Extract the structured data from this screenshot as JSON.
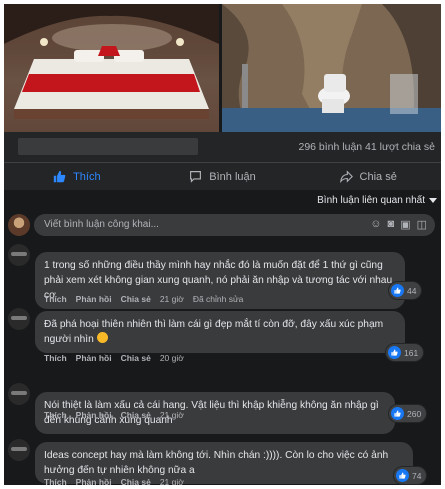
{
  "post": {
    "stats_text": "296 bình luận  41 lượt chia sẻ"
  },
  "actions": {
    "like_label": "Thích",
    "comment_label": "Bình luận",
    "share_label": "Chia sẻ"
  },
  "sort": {
    "label": "Bình luận liên quan nhất"
  },
  "composer": {
    "placeholder": "Viết bình luận công khai..."
  },
  "comments": [
    {
      "text": "1 trong số những điều thầy mình hay nhắc đó là muốn đặt để 1 thứ gì cũng phải xem xét không gian xung quanh, nó phải ăn nhập và tương tác với nhau cơ",
      "like_label": "Thích",
      "reply_label": "Phản hồi",
      "share_label": "Chia sẻ",
      "time": "21 giờ",
      "edited": "Đã chỉnh sửa",
      "reactions": "44"
    },
    {
      "text": "Đã phá hoại thiên nhiên thì làm cái gì đẹp mắt tí còn đỡ, đây xấu xúc phạm người nhìn",
      "like_label": "Thích",
      "reply_label": "Phản hồi",
      "share_label": "Chia sẻ",
      "time": "20 giờ",
      "reactions": "161"
    },
    {
      "text": "Nói thiệt là làm xấu cả cái hang. Vật liệu thì khập khiễng không ăn nhập gì đến khung cảnh xung quanh",
      "like_label": "Thích",
      "reply_label": "Phản hồi",
      "share_label": "Chia sẻ",
      "time": "21 giờ",
      "reactions": "260"
    },
    {
      "text": "Ideas concept hay mà làm không tới. Nhìn chán :)))). Còn lo cho việc có ảnh hưởng đến tự nhiên không nữa a",
      "like_label": "Thích",
      "reply_label": "Phản hồi",
      "share_label": "Chia sẻ",
      "time": "21 giờ",
      "reactions": "74"
    }
  ],
  "icons": {
    "like": "thumbs-up-icon",
    "comment": "speech-bubble-icon",
    "share": "share-arrow-icon",
    "sort_caret": "chevron-down-icon",
    "emoji": "smiley-icon",
    "camera": "camera-icon",
    "gif": "gif-icon",
    "sticker": "sticker-icon"
  },
  "colors": {
    "background": "#18191a",
    "surface": "#242526",
    "bubble": "#3a3b3c",
    "accent": "#2d88ff",
    "text": "#e4e6eb",
    "secondary_text": "#b0b3b8"
  }
}
